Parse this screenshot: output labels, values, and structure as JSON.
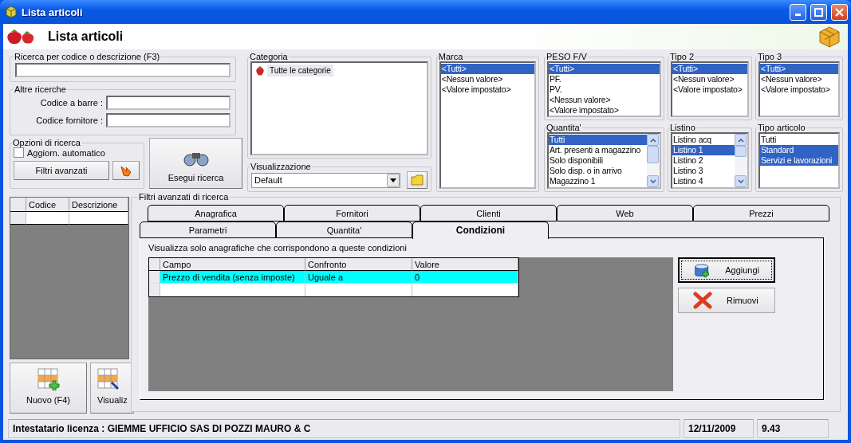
{
  "window": {
    "title": "Lista articoli"
  },
  "header": {
    "title": "Lista articoli"
  },
  "search": {
    "label": "Ricerca per codice o descrizione (F3)"
  },
  "other_searches": {
    "label": "Altre ricerche",
    "fields": [
      {
        "label": "Codice a barre :"
      },
      {
        "label": "Codice fornitore :"
      }
    ]
  },
  "options": {
    "label": "Opzioni di ricerca",
    "auto_update": {
      "label": "Aggiorn. automatico",
      "checked": false
    },
    "advanced_button": "Filtri avanzati"
  },
  "search_button": "Esegui ricerca",
  "category": {
    "label": "Categoria",
    "items": [
      {
        "label": "Tutte le categorie",
        "selected": true
      }
    ]
  },
  "view": {
    "label": "Visualizzazione",
    "value": "Default"
  },
  "filters": [
    {
      "label": "Marca",
      "kind": "plain",
      "items": [
        {
          "label": "<Tutti>",
          "selected": true
        },
        {
          "label": "<Nessun valore>",
          "selected": false
        },
        {
          "label": "<Valore impostato>",
          "selected": false
        }
      ]
    },
    {
      "label": "PESO F/V",
      "kind": "plain",
      "items": [
        {
          "label": "<Tutti>",
          "selected": true
        },
        {
          "label": "PF.",
          "selected": false
        },
        {
          "label": "PV.",
          "selected": false
        },
        {
          "label": "<Nessun valore>",
          "selected": false
        },
        {
          "label": "<Valore impostato>",
          "selected": false
        }
      ]
    },
    {
      "label": "Tipo 2",
      "kind": "plain",
      "items": [
        {
          "label": "<Tutti>",
          "selected": true
        },
        {
          "label": "<Nessun valore>",
          "selected": false
        },
        {
          "label": "<Valore impostato>",
          "selected": false
        }
      ]
    },
    {
      "label": "Tipo 3",
      "kind": "plain",
      "items": [
        {
          "label": "<Tutti>",
          "selected": true
        },
        {
          "label": "<Nessun valore>",
          "selected": false
        },
        {
          "label": "<Valore impostato>",
          "selected": false
        }
      ]
    },
    {
      "label": "Quantita'",
      "kind": "scrolling",
      "items": [
        {
          "label": "Tutti",
          "selected": true
        },
        {
          "label": "Art. presenti a magazzino",
          "selected": false
        },
        {
          "label": "Solo disponibili",
          "selected": false
        },
        {
          "label": "Solo disp. o in arrivo",
          "selected": false
        },
        {
          "label": "Magazzino 1",
          "selected": false
        }
      ]
    },
    {
      "label": "Listino",
      "kind": "scrolling",
      "items": [
        {
          "label": "Listino acq",
          "selected": false
        },
        {
          "label": "Listino 1",
          "selected": true
        },
        {
          "label": "Listino 2",
          "selected": false
        },
        {
          "label": "Listino 3",
          "selected": false
        },
        {
          "label": "Listino 4",
          "selected": false
        }
      ]
    },
    {
      "label": "Tipo articolo",
      "kind": "plain",
      "items": [
        {
          "label": "Tutti",
          "selected": false
        },
        {
          "label": "Standard",
          "selected": true
        },
        {
          "label": "Servizi e lavorazioni",
          "selected": true
        }
      ]
    }
  ],
  "grid": {
    "columns": [
      "Codice",
      "Descrizione"
    ]
  },
  "actions": [
    {
      "label": "Nuovo (F4)",
      "kind": "new"
    },
    {
      "label": "Visualiz",
      "kind": "view"
    }
  ],
  "advanced": {
    "title": "Filtri avanzati di ricerca",
    "tab_rows": [
      [
        {
          "label": "Anagrafica",
          "selected": false
        },
        {
          "label": "Fornitori",
          "selected": false
        },
        {
          "label": "Clienti",
          "selected": false
        },
        {
          "label": "Web",
          "selected": false
        },
        {
          "label": "Prezzi",
          "selected": false
        }
      ],
      [
        {
          "label": "Parametri",
          "selected": false
        },
        {
          "label": "Quantita'",
          "selected": false
        },
        {
          "label": "Condizioni",
          "selected": true
        }
      ]
    ],
    "hint": "Visualizza solo anagrafiche che corrispondono a queste condizioni",
    "conditions": {
      "columns": [
        "Campo",
        "Confronto",
        "Valore"
      ],
      "rows": [
        {
          "cells": [
            "Prezzo di vendita (senza imposte)",
            "Uguale a",
            "0"
          ],
          "selected": true
        }
      ]
    },
    "buttons": [
      {
        "label": "Aggiungi",
        "kind": "add",
        "focused": true
      },
      {
        "label": "Rimuovi",
        "kind": "remove",
        "focused": false
      }
    ]
  },
  "status_bar": {
    "license": "Intestatario licenza : GIEMME UFFICIO SAS DI POZZI MAURO & C",
    "date": "12/11/2009",
    "time": "9.43"
  }
}
